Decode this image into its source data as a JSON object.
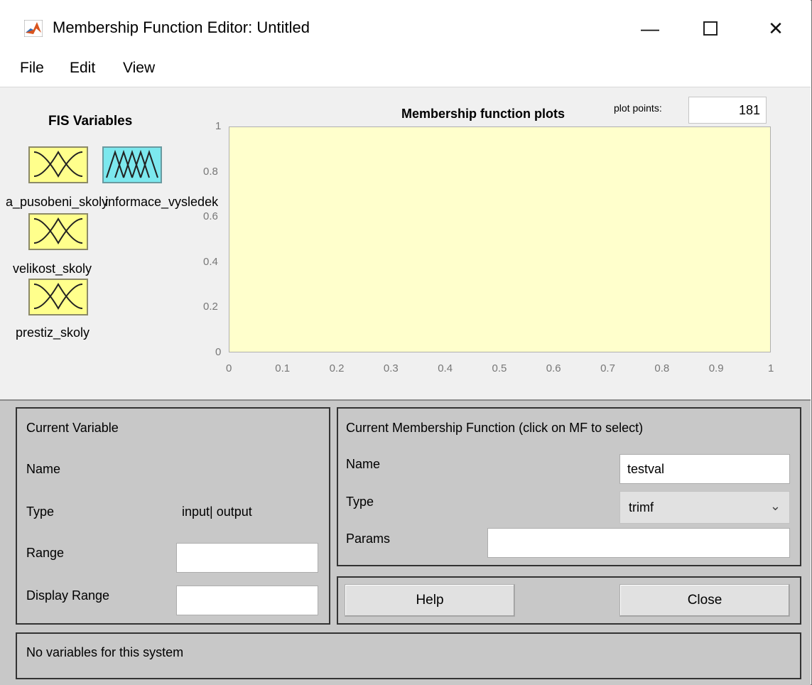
{
  "window": {
    "title": "Membership Function Editor: Untitled",
    "icon": "matlab-logo-icon",
    "controls": [
      "minimize-icon",
      "maximize-icon",
      "close-icon"
    ]
  },
  "menu": {
    "file": "File",
    "edit": "Edit",
    "view": "View"
  },
  "fis": {
    "title": "FIS Variables",
    "variables": [
      {
        "name": "pa_pusobeni_skoly",
        "kind": "input"
      },
      {
        "name": "informace_vysledek",
        "kind": "output"
      },
      {
        "name": "velikost_skoly",
        "kind": "input"
      },
      {
        "name": "prestiz_skoly",
        "kind": "input"
      }
    ],
    "overlap_label_left": "a_pusobeni_skoly",
    "overlap_label_right": "informace_vysledek"
  },
  "plot": {
    "title": "Membership function plots",
    "plot_points_label": "plot points:",
    "plot_points_value": "181",
    "background_color": "#ffffcc",
    "y_ticks": [
      "1",
      "0.8",
      "0.6",
      "0.4",
      "0.2",
      "0"
    ],
    "x_ticks": [
      "0",
      "0.1",
      "0.2",
      "0.3",
      "0.4",
      "0.5",
      "0.6",
      "0.7",
      "0.8",
      "0.9",
      "1"
    ],
    "xlim": [
      0,
      1
    ],
    "ylim": [
      0,
      1
    ]
  },
  "current_variable": {
    "title": "Current Variable",
    "name_label": "Name",
    "type_label": "Type",
    "type_value": "input| output",
    "range_label": "Range",
    "range_value": "",
    "display_range_label": "Display Range",
    "display_range_value": ""
  },
  "current_mf": {
    "title": "Current Membership Function (click on MF to select)",
    "name_label": "Name",
    "name_value": "testval",
    "type_label": "Type",
    "type_value": "trimf",
    "params_label": "Params",
    "params_value": ""
  },
  "buttons": {
    "help": "Help",
    "close": "Close"
  },
  "status": {
    "message": "No variables for this system"
  }
}
